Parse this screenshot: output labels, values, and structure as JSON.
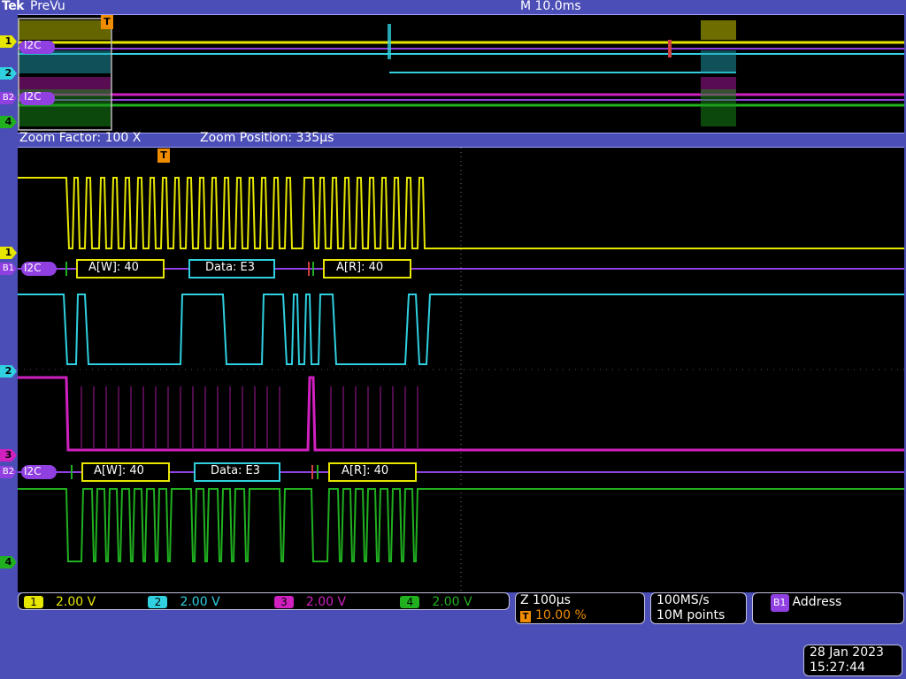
{
  "header": {
    "brand": "Tek",
    "view_label": "PreVu",
    "timebase": "M 10.0ms"
  },
  "zoom": {
    "factor": "Zoom Factor: 100 X",
    "position": "Zoom Position: 335µs"
  },
  "markers": {
    "ch1": "1",
    "b1": "B1",
    "ch2": "2",
    "ch3": "3",
    "b2": "B2",
    "ch4": "4",
    "trigger": "T"
  },
  "bus_label": "I2C",
  "bus1_packets": [
    "A[W]: 40",
    "Data: E3",
    "A[R]: 40"
  ],
  "bus2_packets": [
    "A[W]: 40",
    "Data: E3",
    "A[R]: 40"
  ],
  "channels": [
    {
      "num": "1",
      "scale": "2.00 V",
      "color": "#e6e600"
    },
    {
      "num": "2",
      "scale": "2.00 V",
      "color": "#30d0e0"
    },
    {
      "num": "3",
      "scale": "2.00 V",
      "color": "#d020c0"
    },
    {
      "num": "4",
      "scale": "2.00 V",
      "color": "#20b020"
    }
  ],
  "horizontal": {
    "zoom_scale": "Z 100µs",
    "trigger_pos": "10.00 %"
  },
  "acquisition": {
    "sample_rate": "100MS/s",
    "record_length": "10M points"
  },
  "bus_readout": {
    "bus": "B1",
    "mode": "Address"
  },
  "datetime": {
    "date": "28 Jan  2023",
    "time": "15:27:44"
  },
  "colors": {
    "ch1": "#e6e600",
    "ch2": "#30d0e0",
    "ch3": "#d020c0",
    "ch4": "#20b020",
    "bus": "#9040e0",
    "background": "#4b4eb6"
  }
}
